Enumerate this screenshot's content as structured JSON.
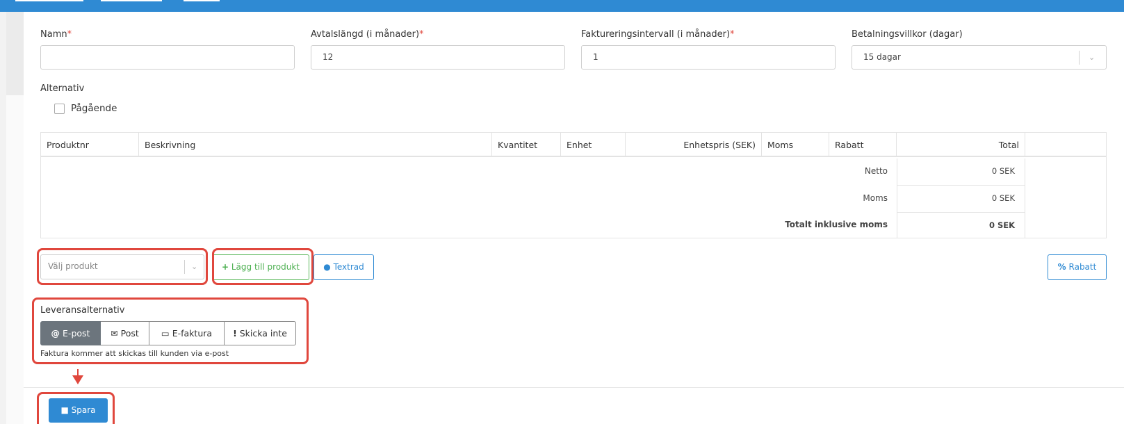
{
  "form": {
    "name_label": "Namn",
    "name_value": "",
    "duration_label": "Avtalslängd (i månader)",
    "duration_value": "12",
    "interval_label": "Faktureringsintervall (i månader)",
    "interval_value": "1",
    "terms_label": "Betalningsvillkor (dagar)",
    "terms_value": "15 dagar",
    "required_mark": "*",
    "options_label": "Alternativ",
    "ongoing_label": "Pågående"
  },
  "table": {
    "headers": [
      "Produktnr",
      "Beskrivning",
      "Kvantitet",
      "Enhet",
      "Enhetspris (SEK)",
      "Moms",
      "Rabatt",
      "Total"
    ],
    "netto_label": "Netto",
    "netto_value": "0 SEK",
    "moms_label": "Moms",
    "moms_value": "0 SEK",
    "total_label": "Totalt inklusive moms",
    "total_value": "0 SEK"
  },
  "actions": {
    "select_product_placeholder": "Välj produkt",
    "add_product_label": "Lägg till produkt",
    "textrad_label": "Textrad",
    "rabatt_label": "Rabatt"
  },
  "delivery": {
    "label": "Leveransalternativ",
    "options": [
      "E-post",
      "Post",
      "E-faktura",
      "Skicka inte"
    ],
    "selected": "E-post",
    "help_text": "Faktura kommer att skickas till kunden via e-post"
  },
  "footer": {
    "save_label": "Spara"
  },
  "colors": {
    "primary": "#2f8ad3",
    "success": "#5cb85c",
    "required": "#e0473d",
    "highlight": "#e0473d",
    "active_segment": "#6c757d"
  }
}
